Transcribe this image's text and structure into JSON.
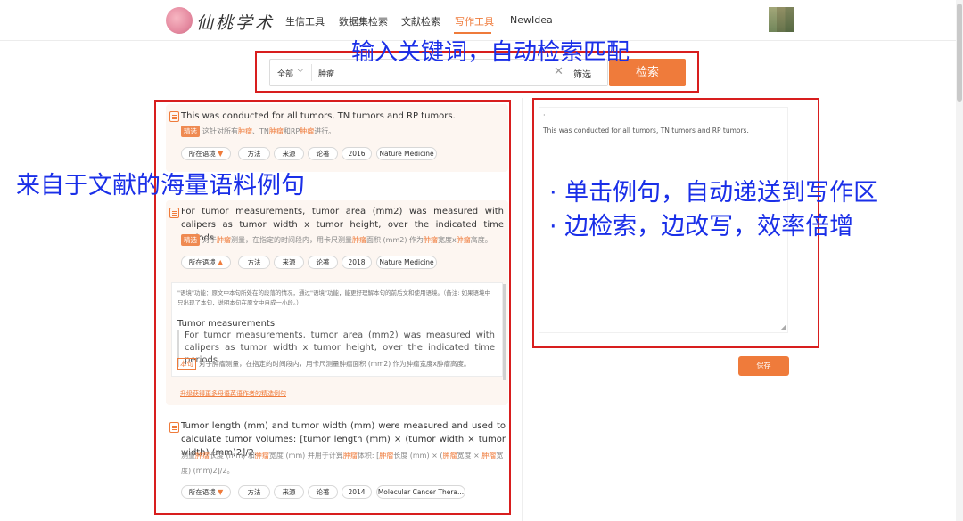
{
  "nav": {
    "logo_text": "仙桃学术",
    "items": [
      "生信工具",
      "数据集检索",
      "文献检索",
      "写作工具",
      "NewIdea"
    ],
    "active": "写作工具"
  },
  "search": {
    "scope": "全部",
    "query": "肿瘤",
    "filter_label": "筛选",
    "button_label": "检索"
  },
  "results": [
    {
      "title": "This was conducted for all tumors, TN tumors and RP tumors.",
      "badge": "精选",
      "translation_parts": [
        "这针对所有",
        "肿瘤",
        "、TN",
        "肿瘤",
        "和RP",
        "肿瘤",
        "进行。"
      ],
      "tags": [
        "所在语境",
        "方法",
        "来源",
        "论著",
        "2016",
        "Nature Medicine"
      ]
    },
    {
      "title": "For tumor measurements, tumor area (mm2) was measured with calipers as tumor width x tumor height, over the indicated time periods.",
      "badge": "精选",
      "translation_parts": [
        "对于",
        "肿瘤",
        "测量，在指定的时间段内，用卡尺测量",
        "肿瘤",
        "面积 (mm2) 作为",
        "肿瘤",
        "宽度x",
        "肿瘤",
        "高度。"
      ],
      "tags": [
        "所在语境",
        "方法",
        "来源",
        "论著",
        "2018",
        "Nature Medicine"
      ],
      "context": {
        "note": "\"语境\"功能：原文中本句所处在的段落的情况，通过\"语境\"功能，能更好理解本句的前后文和使用语境。（备注: 如果语境中只出现了本句，说明本句在原文中自成一小段。）",
        "heading": "Tumor measurements",
        "quote": "For tumor measurements, tumor area (mm2) was measured with calipers as tumor width x tumor height, over the indicated time periods.",
        "tr_badge": "本句",
        "tr_text": "对于肿瘤测量，在指定的时间段内，用卡尺测量肿瘤面积 (mm2) 作为肿瘤宽度x肿瘤高度。",
        "upgrade_link": "升级获得更多母语英语作者的精选例句"
      }
    },
    {
      "title": "Tumor length (mm) and tumor width (mm) were measured and used to calculate tumor volumes: [tumor length (mm) × (tumor width × tumor width) (mm)2]/2.",
      "translation_parts": [
        "测量",
        "肿瘤",
        "长度 (mm) 和",
        "肿瘤",
        "宽度 (mm) 并用于计算",
        "肿瘤",
        "体积: [",
        "肿瘤",
        "长度 (mm) × (",
        "肿瘤",
        "宽度 × ",
        "肿瘤",
        "宽度) (mm)2]/2。"
      ],
      "tags": [
        "所在语境",
        "方法",
        "来源",
        "论著",
        "2014",
        "Molecular Cancer Thera..."
      ]
    }
  ],
  "editor": {
    "dot": "·",
    "text": "This was conducted for all tumors, TN tumors and RP tumors.",
    "save_label": "保存"
  },
  "annotations": {
    "search_caption": "输入关键词，自动检索匹配",
    "corpus_caption": "来自于文献的海量语料例句",
    "editor_caption_1": "· 单击例句，自动递送到写作区",
    "editor_caption_2": "· 边检索，边改写，效率倍增"
  },
  "colors": {
    "accent": "#ef7b3b",
    "annotation_box": "#d81e1e",
    "annotation_text": "#1a2fe8"
  }
}
